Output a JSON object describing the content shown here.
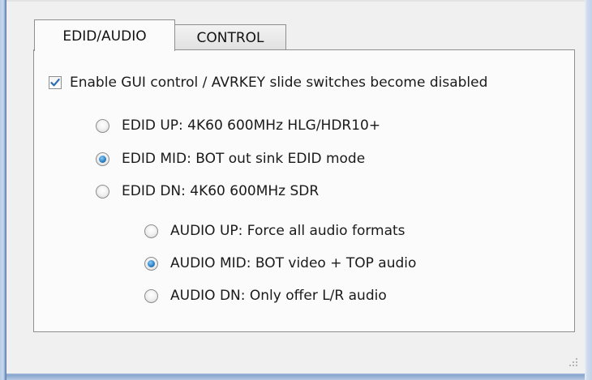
{
  "tabs": {
    "edid_audio": "EDID/AUDIO",
    "control": "CONTROL"
  },
  "enable_gui": {
    "label": "Enable GUI control / AVRKEY slide switches become disabled",
    "checked": true
  },
  "edid_options": [
    {
      "label": "EDID UP: 4K60 600MHz HLG/HDR10+",
      "selected": false
    },
    {
      "label": "EDID MID: BOT out sink EDID mode",
      "selected": true
    },
    {
      "label": "EDID DN: 4K60 600MHz SDR",
      "selected": false
    }
  ],
  "audio_options": [
    {
      "label": "AUDIO UP: Force all audio formats",
      "selected": false
    },
    {
      "label": "AUDIO MID: BOT video + TOP audio",
      "selected": true
    },
    {
      "label": "AUDIO DN:  Only offer L/R audio",
      "selected": false
    }
  ],
  "colors": {
    "checkmark": "#2a6db3",
    "radio_selected": "#2c84c8",
    "window_frame": "#5677a9"
  }
}
